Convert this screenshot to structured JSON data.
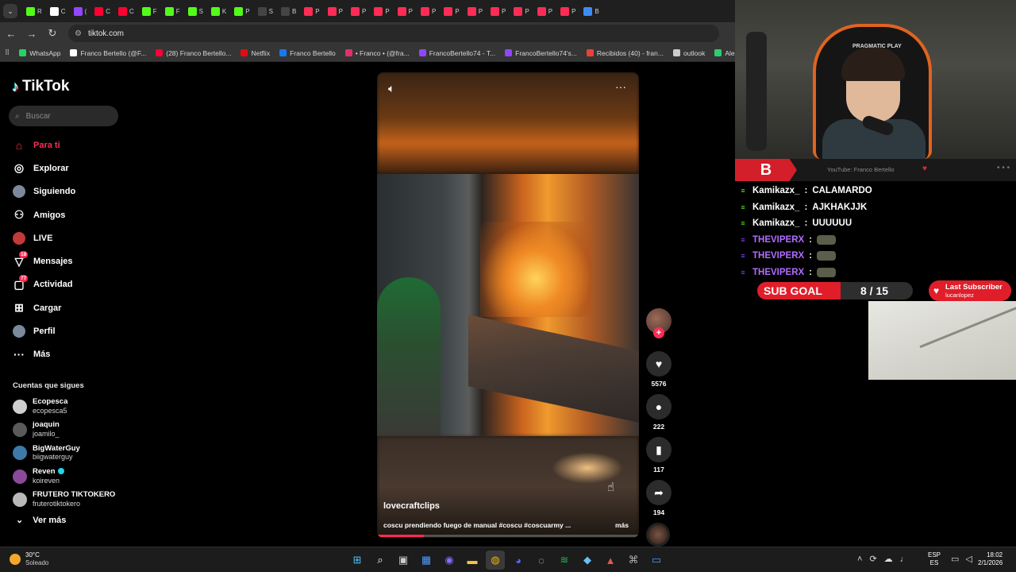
{
  "browser": {
    "tabs": [
      {
        "label": "R",
        "color": "#53fc18"
      },
      {
        "label": "C",
        "color": "#ffffff"
      },
      {
        "label": "(",
        "color": "#9146ff"
      },
      {
        "label": "C",
        "color": "#ff0033"
      },
      {
        "label": "C",
        "color": "#ff0033"
      },
      {
        "label": "F",
        "color": "#53fc18"
      },
      {
        "label": "F",
        "color": "#53fc18"
      },
      {
        "label": "S",
        "color": "#53fc18"
      },
      {
        "label": "K",
        "color": "#53fc18"
      },
      {
        "label": "P",
        "color": "#53fc18"
      },
      {
        "label": "S",
        "color": "#444444"
      },
      {
        "label": "B",
        "color": "#444444"
      },
      {
        "label": "P",
        "color": "#fe2c55"
      },
      {
        "label": "P",
        "color": "#fe2c55"
      },
      {
        "label": "P",
        "color": "#fe2c55"
      },
      {
        "label": "P",
        "color": "#fe2c55"
      },
      {
        "label": "P",
        "color": "#fe2c55"
      },
      {
        "label": "P",
        "color": "#fe2c55"
      },
      {
        "label": "P",
        "color": "#fe2c55"
      },
      {
        "label": "P",
        "color": "#fe2c55"
      },
      {
        "label": "P",
        "color": "#fe2c55"
      },
      {
        "label": "P",
        "color": "#fe2c55"
      },
      {
        "label": "P",
        "color": "#fe2c55"
      },
      {
        "label": "P",
        "color": "#fe2c55"
      },
      {
        "label": "B",
        "color": "#3c8cf4"
      }
    ],
    "url": "tiktok.com",
    "bookmarks": [
      {
        "label": "WhatsApp",
        "color": "#25d366"
      },
      {
        "label": "Franco Bertello (@F...",
        "color": "#ffffff"
      },
      {
        "label": "(28) Franco Bertello...",
        "color": "#ff0033"
      },
      {
        "label": "Netflix",
        "color": "#e50914"
      },
      {
        "label": "Franco Bertello",
        "color": "#1877f2"
      },
      {
        "label": "• Franco • (@fra...",
        "color": "#e1306c"
      },
      {
        "label": "FrancoBertello74 - T...",
        "color": "#9146ff"
      },
      {
        "label": "FrancoBertello74's...",
        "color": "#9146ff"
      },
      {
        "label": "Recibidos (40) - fran...",
        "color": "#ea4335"
      },
      {
        "label": "outlook",
        "color": "#cccccc"
      },
      {
        "label": "Aler",
        "color": "#2ecc71"
      }
    ]
  },
  "tiktok": {
    "logo": "TikTok",
    "search_placeholder": "Buscar",
    "nav": [
      {
        "label": "Para ti",
        "icon": "home-icon",
        "glyph": "⌂",
        "active": true,
        "badge": ""
      },
      {
        "label": "Explorar",
        "icon": "compass-icon",
        "glyph": "◎",
        "active": false,
        "badge": ""
      },
      {
        "label": "Siguiendo",
        "icon": "following-avatar-icon",
        "glyph": "",
        "active": false,
        "badge": ""
      },
      {
        "label": "Amigos",
        "icon": "friends-icon",
        "glyph": "⚇",
        "active": false,
        "badge": ""
      },
      {
        "label": "LIVE",
        "icon": "live-icon",
        "glyph": "",
        "active": false,
        "badge": ""
      },
      {
        "label": "Mensajes",
        "icon": "messages-icon",
        "glyph": "▽",
        "active": false,
        "badge": "18"
      },
      {
        "label": "Actividad",
        "icon": "activity-icon",
        "glyph": "▢",
        "active": false,
        "badge": "77"
      },
      {
        "label": "Cargar",
        "icon": "upload-icon",
        "glyph": "⊞",
        "active": false,
        "badge": ""
      },
      {
        "label": "Perfil",
        "icon": "profile-avatar-icon",
        "glyph": "",
        "active": false,
        "badge": ""
      },
      {
        "label": "Más",
        "icon": "more-icon",
        "glyph": "···",
        "active": false,
        "badge": ""
      }
    ],
    "following_title": "Cuentas que sigues",
    "following": [
      {
        "name": "Ecopesca",
        "user": "ecopesca5",
        "verified": false,
        "color": "#cfcfcf"
      },
      {
        "name": "joaquin",
        "user": "joamilo_",
        "verified": false,
        "color": "#5a5a5a"
      },
      {
        "name": "BigWaterGuy",
        "user": "biigwaterguy",
        "verified": false,
        "color": "#3d7aa8"
      },
      {
        "name": "Reven",
        "user": "koireven",
        "verified": true,
        "color": "#8a4a9a"
      },
      {
        "name": "FRUTERO TIKTOKERO",
        "user": "fruterotiktokero",
        "verified": false,
        "color": "#b8b8b8"
      }
    ],
    "see_more": "Ver más",
    "video": {
      "author": "lovecraftclips",
      "caption": "coscu prendiendo fuego de manual #coscu #coscuarmy ...",
      "more": "más",
      "progress": 0.18,
      "likes": "5576",
      "comments": "222",
      "saves": "117",
      "shares": "194"
    }
  },
  "stream": {
    "chair_brand": "PRAGMATIC PLAY",
    "yt_logo": "B",
    "yt_label": "YouTube: Franco Bertello",
    "chat": [
      {
        "user": "Kamikazx_",
        "msg": "CALAMARDO",
        "user_color": "#ffffff",
        "badge_color": "#53fc18",
        "badge": "≡",
        "emote": false
      },
      {
        "user": "Kamikazx_",
        "msg": "AJKHAKJJK",
        "user_color": "#ffffff",
        "badge_color": "#53fc18",
        "badge": "≡",
        "emote": false
      },
      {
        "user": "Kamikazx_",
        "msg": "UUUUUU",
        "user_color": "#ffffff",
        "badge_color": "#53fc18",
        "badge": "≡",
        "emote": false
      },
      {
        "user": "THEVIPERX",
        "msg": "",
        "user_color": "#b26cff",
        "badge_color": "#9146ff",
        "badge": "≡",
        "emote": true
      },
      {
        "user": "THEVIPERX",
        "msg": "",
        "user_color": "#b26cff",
        "badge_color": "#9146ff",
        "badge": "≡",
        "emote": true
      },
      {
        "user": "THEVIPERX",
        "msg": "",
        "user_color": "#b26cff",
        "badge_color": "#9146ff",
        "badge": "≡",
        "emote": true
      }
    ],
    "sub_goal_label": "SUB GOAL",
    "sub_goal_count": "8 / 15",
    "sub_goal_fraction": 0.5333,
    "last_sub_title": "Last Subscriber",
    "last_sub_name": "lucanlopez"
  },
  "taskbar": {
    "weather_temp": "30°C",
    "weather_cond": "Soleado",
    "apps": [
      {
        "name": "start-icon",
        "glyph": "⊞",
        "color": "#4cc2ff"
      },
      {
        "name": "search-icon",
        "glyph": "⌕",
        "color": "#ffffff"
      },
      {
        "name": "task-view-icon",
        "glyph": "▣",
        "color": "#cccccc"
      },
      {
        "name": "widgets-icon",
        "glyph": "▦",
        "color": "#4c9aff"
      },
      {
        "name": "circle-app-icon",
        "glyph": "◉",
        "color": "#8a6cff"
      },
      {
        "name": "file-explorer-icon",
        "glyph": "▬",
        "color": "#f4c542"
      },
      {
        "name": "chrome-icon",
        "glyph": "◍",
        "color": "#f4b400"
      },
      {
        "name": "discord-icon",
        "glyph": "◕",
        "color": "#5865f2"
      },
      {
        "name": "obs-icon",
        "glyph": "◌",
        "color": "#dddddd"
      },
      {
        "name": "spotify-icon",
        "glyph": "≋",
        "color": "#1db954"
      },
      {
        "name": "steam-icon",
        "glyph": "◆",
        "color": "#66c0f4"
      },
      {
        "name": "gamepad-icon",
        "glyph": "▲",
        "color": "#e05a4a"
      },
      {
        "name": "network-app-icon",
        "glyph": "⌘",
        "color": "#aaaaaa"
      },
      {
        "name": "monitor-app-icon",
        "glyph": "▭",
        "color": "#4c9aff"
      }
    ],
    "lang_1": "ESP",
    "lang_2": "ES",
    "time": "18:02",
    "date": "2/1/2026"
  }
}
